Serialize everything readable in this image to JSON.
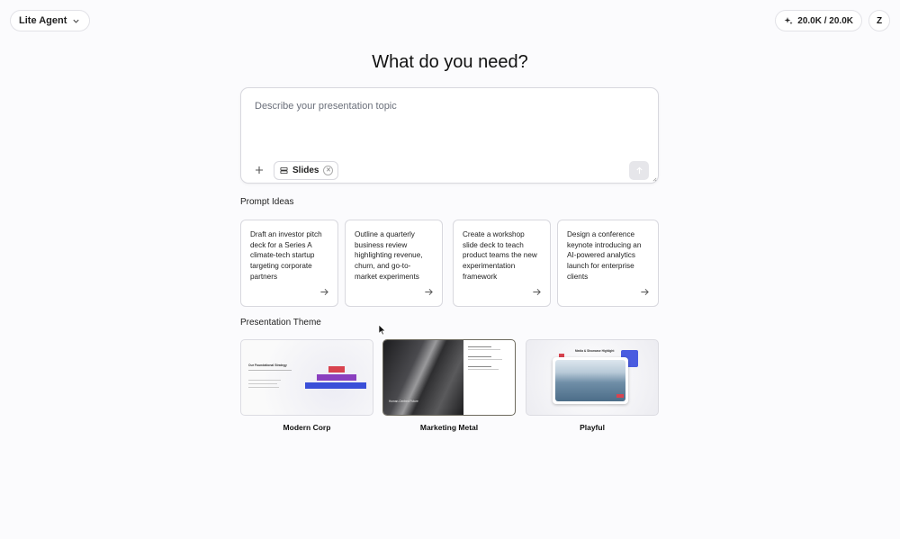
{
  "header": {
    "agent_label": "Lite Agent",
    "credits": "20.0K / 20.0K",
    "avatar_initial": "Z"
  },
  "main": {
    "title": "What do you need?",
    "prompt_placeholder": "Describe your presentation topic",
    "chip_label": "Slides"
  },
  "prompt_ideas": {
    "label": "Prompt Ideas",
    "items": [
      "Draft an investor pitch deck for a Series A climate-tech startup targeting corporate partners",
      "Outline a quarterly business review highlighting revenue, churn, and go-to-market experiments",
      "Create a workshop slide deck to teach product teams the new experimentation framework",
      "Design a conference keynote introducing an AI-powered analytics launch for enterprise clients"
    ]
  },
  "themes": {
    "label": "Presentation Theme",
    "items": [
      {
        "name": "Modern Corp",
        "selected": false
      },
      {
        "name": "Marketing Metal",
        "selected": true
      },
      {
        "name": "Playful",
        "selected": false
      }
    ],
    "thumb_text": {
      "modern_corp_title": "Our Foundational Strategy",
      "metal_caption": "Human-Centred Future",
      "playful_title": "Media & Showcase Highlight"
    }
  },
  "colors": {
    "accent_blue": "#3a4fd8",
    "accent_purple": "#8a3fbf",
    "accent_red": "#d8434f"
  },
  "icons": {
    "agent_dropdown": "chevron-down-icon",
    "credits": "sparkle-icon",
    "add": "plus-icon",
    "chip": "layers-icon",
    "chip_remove": "close-icon",
    "send": "arrow-up-icon",
    "idea": "arrow-right-icon"
  }
}
